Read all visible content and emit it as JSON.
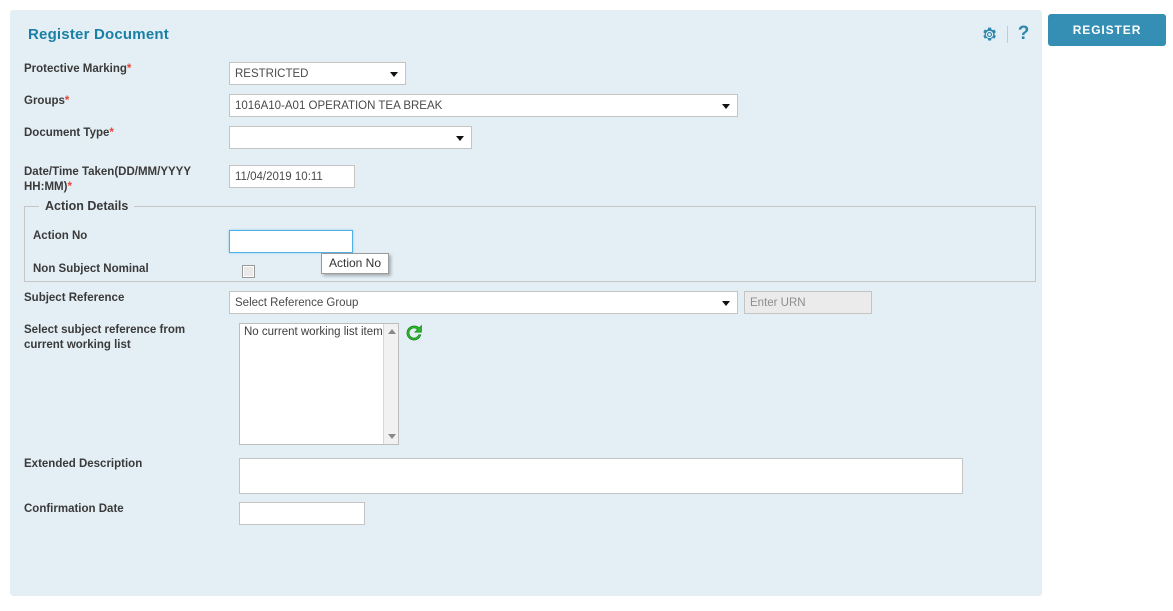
{
  "panel": {
    "title": "Register Document"
  },
  "header": {
    "gear_icon": "gear-icon",
    "help_icon": "question-mark-icon",
    "register_label": "REGISTER",
    "accent_color": "#2e87ad",
    "button_color": "#358fb4"
  },
  "form": {
    "protective_marking": {
      "label": "Protective Marking",
      "required": "*",
      "value": "RESTRICTED"
    },
    "groups": {
      "label": "Groups",
      "required": "*",
      "value": "1016A10-A01 OPERATION TEA BREAK"
    },
    "document_type": {
      "label": "Document Type",
      "required": "*",
      "value": ""
    },
    "date_time_taken": {
      "label": "Date/Time Taken(DD/MM/YYYY HH:MM)",
      "required": "*",
      "value": "11/04/2019 10:11"
    },
    "subject_reference": {
      "label": "Subject Reference",
      "value": "Select Reference Group",
      "urn_placeholder": "Enter URN",
      "urn_value": ""
    },
    "working_list": {
      "label": "Select subject reference from current working list",
      "empty_text": "No current working list items",
      "refresh_icon": "refresh-icon"
    },
    "extended_description": {
      "label": "Extended Description",
      "value": ""
    },
    "confirmation_date": {
      "label": "Confirmation Date",
      "value": ""
    }
  },
  "action_details": {
    "legend": "Action Details",
    "action_no": {
      "label": "Action No",
      "value": ""
    },
    "non_subject_nominal": {
      "label": "Non Subject Nominal",
      "checked": false
    },
    "tooltip": "Action No"
  }
}
